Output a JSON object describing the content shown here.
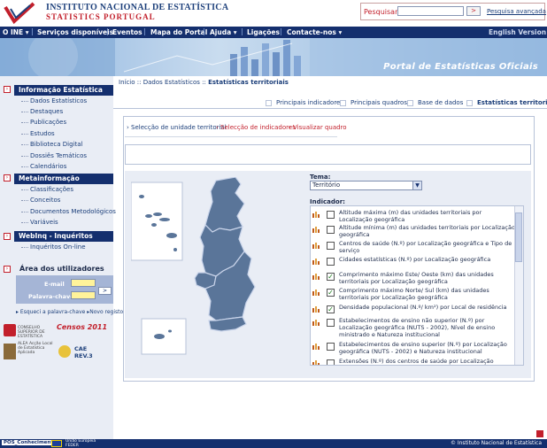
{
  "header": {
    "org_line1": "INSTITUTO NACIONAL DE ESTATÍSTICA",
    "org_line2": "STATISTICS PORTUGAL",
    "search_label": "Pesquisar",
    "search_value": "",
    "search_go": ">",
    "search_advanced": "Pesquisa avançada"
  },
  "topnav": {
    "items": [
      "O INE ▾",
      "Serviços disponíveis",
      "Eventos",
      "Mapa do Portal",
      "Ajuda ▾",
      "Ligações",
      "Contacte-nos ▾"
    ],
    "english": "English Version"
  },
  "banner": {
    "title": "Portal de Estatísticas Oficiais"
  },
  "sidebar": {
    "info_title": "Informação Estatística",
    "info_items": [
      "Dados Estatísticos",
      "Destaques",
      "Publicações",
      "Estudos",
      "Biblioteca Digital",
      "Dossiês Temáticos",
      "Calendários"
    ],
    "meta_title": "Metainformação",
    "meta_items": [
      "Classificações",
      "Conceitos",
      "Documentos Metodológicos",
      "Variáveis"
    ],
    "webinq_title": "WebInq - Inquéritos",
    "webinq_items": [
      "Inquéritos On-line"
    ],
    "users_title": "Área dos utilizadores",
    "email_label": "E-mail",
    "password_label": "Palavra-chave",
    "login_go": ">",
    "forgot": "Esqueci a palavra-chave",
    "register": "Novo registo",
    "logos": [
      "CONSELHO SUPERIOR DE ESTATÍSTICA",
      "Censos 2011",
      "ALEA Acção Local de Estatística Aplicada",
      "CAE REV.3"
    ]
  },
  "breadcrumb": {
    "home": "Início",
    "level1": "Dados Estatísticos",
    "current": "Estatísticas territoriais"
  },
  "tabs": [
    "Principais indicadores",
    "Principais quadros",
    "Base de dados",
    "Estatísticas territoriais"
  ],
  "steps": [
    "Selecção de unidade territorial",
    "Selecção de indicadores",
    "Visualizar quadro"
  ],
  "tema": {
    "label": "Tema:",
    "selected": "Território"
  },
  "indicador": {
    "label": "Indicador:",
    "items": [
      {
        "text": "Altitude máxima (m) das unidades territoriais por Localização geográfica",
        "checked": false
      },
      {
        "text": "Altitude mínima (m) das unidades territoriais por Localização geográfica",
        "checked": false
      },
      {
        "text": "Centros de saúde (N.º) por Localização geográfica e Tipo de serviço",
        "checked": false
      },
      {
        "text": "Cidades estatísticas (N.º) por Localização geográfica",
        "checked": false
      },
      {
        "text": "Comprimento máximo Este/ Oeste (km) das unidades territoriais por Localização geográfica",
        "checked": true
      },
      {
        "text": "Comprimento máximo Norte/ Sul (km) das unidades territoriais por Localização geográfica",
        "checked": true
      },
      {
        "text": "Densidade populacional (N.º/ km²) por Local de residência",
        "checked": true
      },
      {
        "text": "Estabelecimentos de ensino não superior (N.º) por Localização geográfica (NUTS - 2002), Nível de ensino ministrado e Natureza institucional",
        "checked": false
      },
      {
        "text": "Estabelecimentos de ensino superior (N.º) por Localização geográfica (NUTS - 2002) e Natureza institucional",
        "checked": false
      },
      {
        "text": "Extensões (N.º) dos centros de saúde por Localização",
        "checked": false
      }
    ]
  },
  "footer": {
    "left_logos": [
      "POS_Conhecimento",
      "União Europeia FEDER"
    ],
    "copyright": "© Instituto Nacional de Estatística"
  },
  "colors": {
    "navy": "#142f6e",
    "red": "#c21f2b",
    "map_fill": "#5a7599",
    "panel": "#e9edf5"
  }
}
